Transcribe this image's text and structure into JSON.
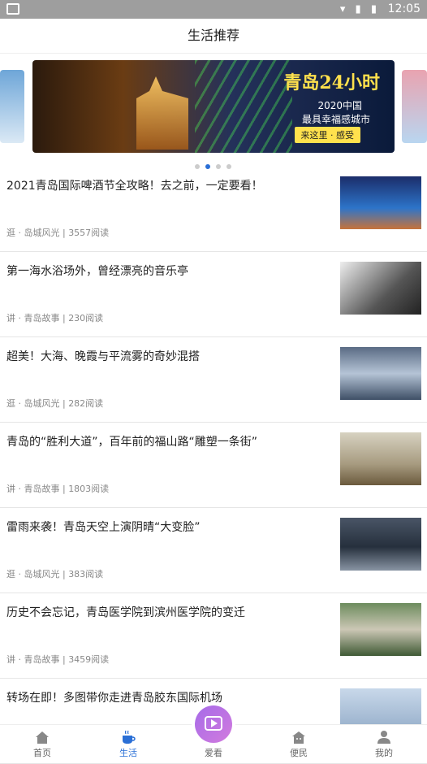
{
  "status": {
    "time": "12:05"
  },
  "header": {
    "title": "生活推荐"
  },
  "banner": {
    "title": "青岛24小时",
    "line1": "2020中国",
    "line2": "最具幸福感城市",
    "button": "来这里 · 感受",
    "page_index": 2,
    "page_count": 4
  },
  "feed": [
    {
      "title": "2021青岛国际啤酒节全攻略！去之前，一定要看！",
      "meta": "逛 · 岛城风光 | 3557阅读"
    },
    {
      "title": "第一海水浴场外，曾经漂亮的音乐亭",
      "meta": "讲 · 青岛故事 | 230阅读"
    },
    {
      "title": "超美！大海、晚霞与平流雾的奇妙混搭",
      "meta": "逛 · 岛城风光 | 282阅读"
    },
    {
      "title": "青岛的“胜利大道”，百年前的福山路“雕塑一条街”",
      "meta": "讲 · 青岛故事 | 1803阅读"
    },
    {
      "title": "雷雨来袭！青岛天空上演阴晴“大变脸”",
      "meta": "逛 · 岛城风光 | 383阅读"
    },
    {
      "title": "历史不会忘记，青岛医学院到滨州医学院的变迁",
      "meta": "讲 · 青岛故事 | 3459阅读"
    },
    {
      "title": "转场在即！多图带你走进青岛胶东国际机场",
      "meta": ""
    }
  ],
  "tabs": [
    {
      "label": "首页",
      "icon": "home-icon"
    },
    {
      "label": "生活",
      "icon": "coffee-cup-icon",
      "active": true
    },
    {
      "label": "爱看",
      "icon": "tv-icon"
    },
    {
      "label": "便民",
      "icon": "service-icon"
    },
    {
      "label": "我的",
      "icon": "user-icon"
    }
  ],
  "colors": {
    "accent": "#2a6fd6",
    "center_button": "#b56de4"
  }
}
